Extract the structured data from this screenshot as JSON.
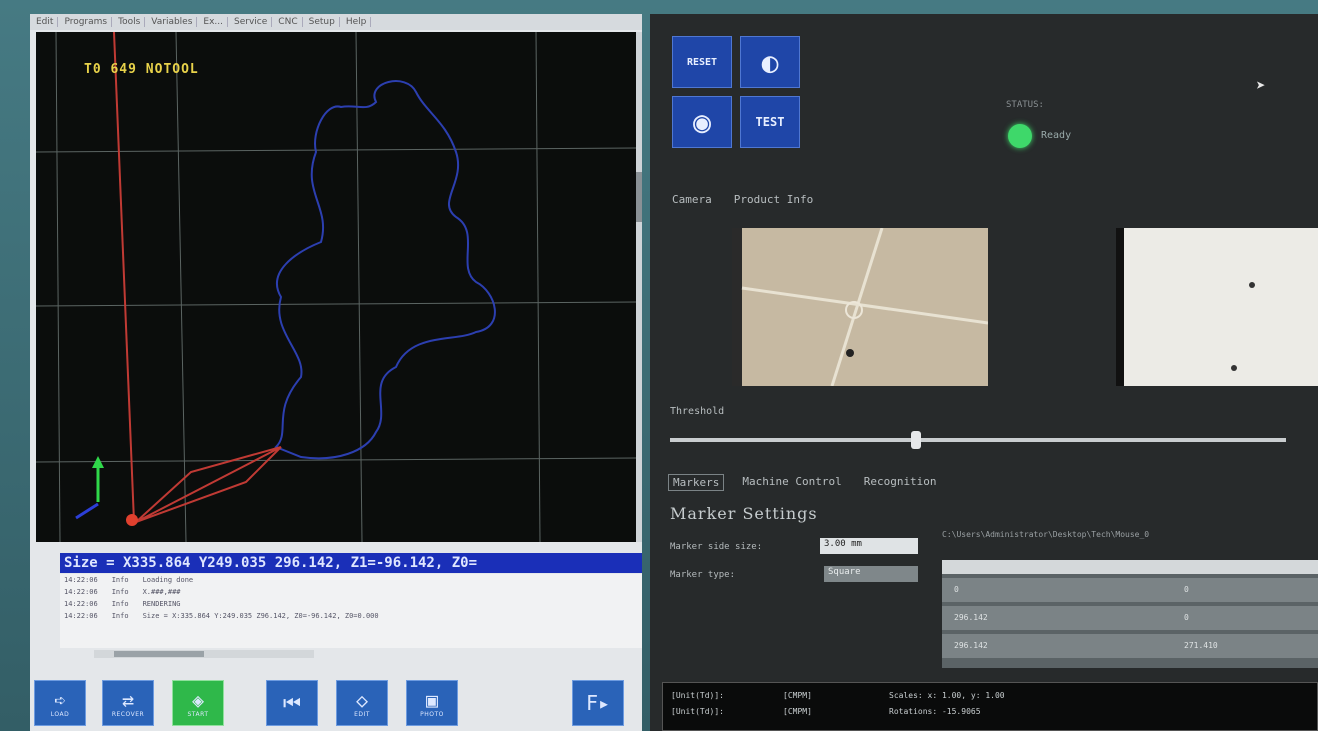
{
  "left_window": {
    "menu": [
      "Edit",
      "Programs",
      "Tools",
      "Variables",
      "Ex...",
      "Service",
      "CNC",
      "Setup",
      "Help"
    ],
    "viewport_label": "T0 649 NOTOOL",
    "status_line": "Size = X335.864 Y249.035 296.142, Z1=-96.142, Z0=",
    "log": [
      {
        "time": "14:22:06",
        "type": "Info",
        "msg": "Loading done"
      },
      {
        "time": "14:22:06",
        "type": "Info",
        "msg": "X.###,###"
      },
      {
        "time": "14:22:06",
        "type": "Info",
        "msg": "RENDERING"
      },
      {
        "time": "14:22:06",
        "type": "Info",
        "msg": "Size = X:335.864 Y:249.035 Z96.142, Z0=-96.142, Z0=0.000"
      }
    ],
    "toolbar": [
      {
        "name": "load",
        "icon": "➪",
        "caption": "LOAD",
        "color": "blue"
      },
      {
        "name": "recover",
        "icon": "⇄",
        "caption": "RECOVER",
        "color": "blue"
      },
      {
        "name": "start",
        "icon": "◈",
        "caption": "START",
        "color": "green"
      },
      {
        "name": "back",
        "icon": "⏮",
        "caption": "",
        "color": "blue"
      },
      {
        "name": "edit",
        "icon": "◇",
        "caption": "EDIT",
        "color": "blue"
      },
      {
        "name": "photo",
        "icon": "▣",
        "caption": "PHOTO",
        "color": "blue"
      },
      {
        "name": "fw",
        "icon": "F▸",
        "caption": "",
        "color": "blue"
      }
    ]
  },
  "right_window": {
    "buttons": [
      {
        "name": "reset",
        "label": "RESET"
      },
      {
        "name": "calibrate",
        "label": "◐"
      },
      {
        "name": "view",
        "label": "◉"
      },
      {
        "name": "test",
        "label": "TEST"
      }
    ],
    "status_label": "STATUS:",
    "status_value": "Ready",
    "tabs_top": [
      "Camera",
      "Product Info"
    ],
    "threshold_label": "Threshold",
    "threshold_value": 0.4,
    "tabs_mid": [
      "Markers",
      "Machine Control",
      "Recognition"
    ],
    "marker_settings_title": "Marker Settings",
    "marker_side_size_label": "Marker side size:",
    "marker_side_size_value": "3.00 mm",
    "marker_type_label": "Marker type:",
    "marker_type_value": "Square",
    "path": "C:\\Users\\Administrator\\Desktop\\Tech\\Mouse_0",
    "grid_rows": [
      {
        "c1": "0",
        "c2": "0"
      },
      {
        "c1": "296.142",
        "c2": "0"
      },
      {
        "c1": "296.142",
        "c2": "271.410"
      }
    ],
    "console": [
      {
        "tag": "[Unit(Td)]:",
        "val": "[CMPM]",
        "msg": "Scales: x: 1.00, y: 1.00"
      },
      {
        "tag": "[Unit(Td)]:",
        "val": "[CMPM]",
        "msg": "Rotations: -15.9065"
      }
    ]
  }
}
